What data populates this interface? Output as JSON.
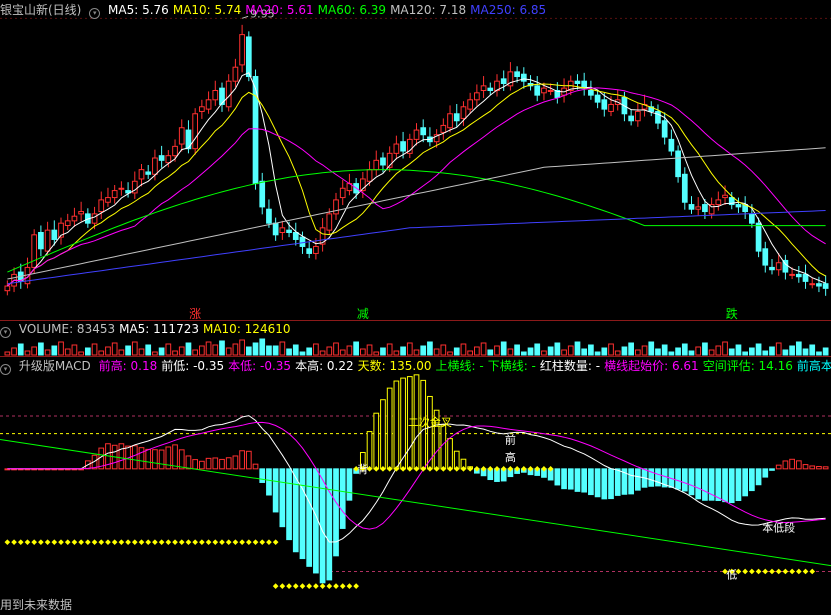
{
  "price_panel": {
    "title": "银宝山新(日线)",
    "ma_labels": [
      {
        "label": "MA5: 5.76",
        "color": "#ffffff"
      },
      {
        "label": "MA10: 5.74",
        "color": "#ffff00"
      },
      {
        "label": "MA20: 5.61",
        "color": "#ff00ff"
      },
      {
        "label": "MA60: 6.39",
        "color": "#00ff00"
      },
      {
        "label": "MA120: 7.18",
        "color": "#c0c0c0"
      },
      {
        "label": "MA250: 6.85",
        "color": "#4040ff"
      }
    ],
    "high_label": "9.95",
    "markers": [
      {
        "text": "涨",
        "color": "#ff3030"
      },
      {
        "text": "减",
        "color": "#00ff00"
      },
      {
        "text": "跌",
        "color": "#00ff00"
      }
    ]
  },
  "volume_panel": {
    "labels": [
      {
        "label": "VOLUME: 83453",
        "color": "#c0c0c0"
      },
      {
        "label": "MA5: 111723",
        "color": "#ffffff"
      },
      {
        "label": "MA10: 124610",
        "color": "#ffff00"
      }
    ]
  },
  "macd_panel": {
    "title": "升级版MACD",
    "labels": [
      {
        "label": "前高: 0.18",
        "color": "#ff00ff"
      },
      {
        "label": "前低: -0.35",
        "color": "#ffffff"
      },
      {
        "label": "本低: -0.35",
        "color": "#ff00ff"
      },
      {
        "label": "本高: 0.22",
        "color": "#ffffff"
      },
      {
        "label": "天数: 135.00",
        "color": "#ffff00"
      },
      {
        "label": "上横线: -",
        "color": "#00ff00"
      },
      {
        "label": "下横线: -",
        "color": "#00ff00"
      },
      {
        "label": "红柱数量: -",
        "color": "#ffffff"
      },
      {
        "label": "横线起始价: 6.61",
        "color": "#ff00ff"
      },
      {
        "label": "空间评估: 14.16",
        "color": "#00ff00"
      },
      {
        "label": "前高本高二分",
        "color": "#00ffff"
      }
    ],
    "annotations": [
      {
        "text": "二次金叉",
        "color": "#ffff00"
      },
      {
        "text": "前",
        "color": "#ffffff"
      },
      {
        "text": "高",
        "color": "#ffffff"
      },
      {
        "text": "背",
        "color": "#ffffff"
      },
      {
        "text": "本低段",
        "color": "#ffffff"
      },
      {
        "text": "低",
        "color": "#ffffff"
      }
    ]
  },
  "footer": {
    "text": "用到未来数据"
  },
  "chart_data": {
    "type": "line",
    "candles_close": [
      4.2,
      4.45,
      4.3,
      4.6,
      5.3,
      5.0,
      5.4,
      5.2,
      5.55,
      5.6,
      5.7,
      5.8,
      5.55,
      5.75,
      6.05,
      6.1,
      6.25,
      6.3,
      6.2,
      6.45,
      6.7,
      6.6,
      6.95,
      6.9,
      7.0,
      7.2,
      7.6,
      7.15,
      7.9,
      8.05,
      8.2,
      8.4,
      8.1,
      8.6,
      8.9,
      9.6,
      8.7,
      6.4,
      5.9,
      5.55,
      5.3,
      5.45,
      5.35,
      5.2,
      5.05,
      4.9,
      5.05,
      5.45,
      5.75,
      6.05,
      6.3,
      6.4,
      6.2,
      6.5,
      6.7,
      6.9,
      6.8,
      7.05,
      7.25,
      7.1,
      7.35,
      7.55,
      7.45,
      7.3,
      7.45,
      7.65,
      7.9,
      7.75,
      8.05,
      8.2,
      8.35,
      8.5,
      8.4,
      8.6,
      8.55,
      8.8,
      8.7,
      8.6,
      8.5,
      8.3,
      8.45,
      8.4,
      8.25,
      8.45,
      8.6,
      8.55,
      8.45,
      8.3,
      8.15,
      8.0,
      8.1,
      8.2,
      7.9,
      7.75,
      7.95,
      8.1,
      7.95,
      7.7,
      7.4,
      7.1,
      6.55,
      6.0,
      5.85,
      5.9,
      5.8,
      5.95,
      6.05,
      6.15,
      5.95,
      5.9,
      5.8,
      5.55,
      4.95,
      4.65,
      4.55,
      4.7,
      4.5,
      4.45,
      4.4,
      4.3,
      4.25,
      4.2,
      4.15
    ],
    "y_price_range": [
      3.9,
      10.0
    ],
    "macd_range": [
      -0.42,
      0.32
    ],
    "series": [
      {
        "name": "MA5",
        "color": "#ffffff"
      },
      {
        "name": "MA10",
        "color": "#ffff00"
      },
      {
        "name": "MA20",
        "color": "#ff00ff"
      },
      {
        "name": "MA60",
        "color": "#00ff00"
      },
      {
        "name": "MA120",
        "color": "#c0c0c0"
      },
      {
        "name": "MA250",
        "color": "#4040ff"
      }
    ]
  }
}
